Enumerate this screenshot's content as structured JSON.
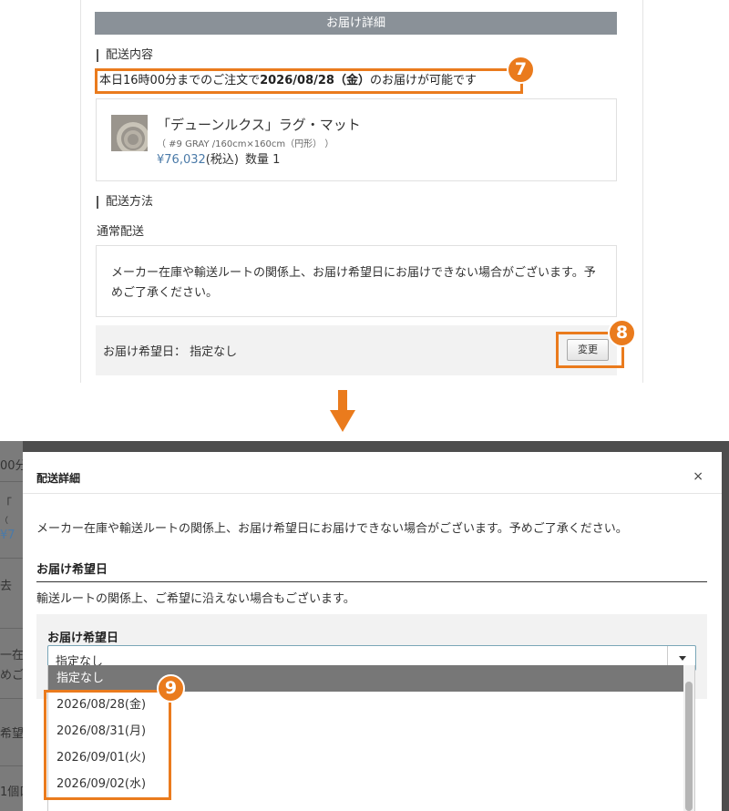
{
  "top": {
    "section_header": "お届け詳細",
    "delivery_contents_heading": "配送内容",
    "notice_prefix": "本日16時00分までのご注文で",
    "notice_date": "2026/08/28（金）",
    "notice_suffix": "のお届けが可能です",
    "product": {
      "name": "「デューンルクス」ラグ・マット",
      "variant": "（ #9 GRAY /160cm×160cm（円形） ）",
      "price": "¥76,032",
      "tax_label": "(税込)",
      "quantity": "数量 1"
    },
    "shipping_method_heading": "配送方法",
    "shipping_method": "通常配送",
    "note": "メーカー在庫や輸送ルートの関係上、お届け希望日にお届けできない場合がございます。予めご了承ください。",
    "desired_date_label": "お届け希望日： 指定なし",
    "change_button": "変更"
  },
  "markers": {
    "m7": "7",
    "m8": "8",
    "m9": "9"
  },
  "bg_fragments": {
    "f1": "00分",
    "f2": "「",
    "f3": "（",
    "f4": "¥7",
    "f5": "去",
    "f6": "一在",
    "f7": "めご",
    "f8": "希望日",
    "f9": "1個口分"
  },
  "modal": {
    "title": "配送詳細",
    "close": "×",
    "description": "メーカー在庫や輸送ルートの関係上、お届け希望日にお届けできない場合がございます。予めご了承ください。",
    "section_title": "お届け希望日",
    "route_note": "輸送ルートの関係上、ご希望に沿えない場合もございます。",
    "field_label": "お届け希望日",
    "selected_value": "指定なし",
    "options": [
      "指定なし",
      "2026/08/28(金)",
      "2026/08/31(月)",
      "2026/09/01(火)",
      "2026/09/02(水)"
    ]
  },
  "colors": {
    "accent_orange": "#ea7b1d",
    "header_gray": "#8a9198",
    "price_blue": "#4a7aa8"
  }
}
